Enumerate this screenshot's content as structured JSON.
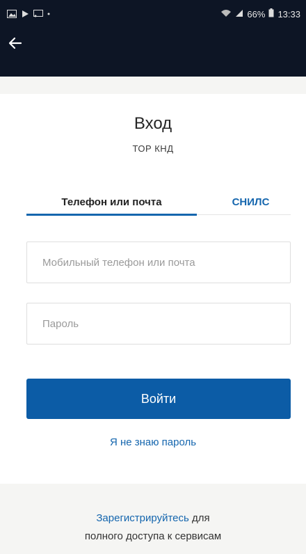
{
  "status_bar": {
    "battery": "66%",
    "time": "13:33",
    "icons": [
      "gallery-icon",
      "play-icon",
      "cast-icon",
      "wifi-icon",
      "signal-icon",
      "battery-icon"
    ]
  },
  "app_bar": {
    "back_icon": "arrow-left-icon"
  },
  "login": {
    "title": "Вход",
    "subtitle": "ТОР КНД",
    "tabs": [
      {
        "label": "Телефон или почта",
        "active": true
      },
      {
        "label": "СНИЛС",
        "active": false
      }
    ],
    "login_placeholder": "Мобильный телефон или почта",
    "login_value": "",
    "password_placeholder": "Пароль",
    "password_value": "",
    "submit_label": "Войти",
    "forgot_label": "Я не знаю пароль"
  },
  "register": {
    "link_label": "Зарегистрируйтесь",
    "text_after": " для",
    "line2": "полного доступа к сервисам"
  },
  "colors": {
    "bar_bg": "#0d1525",
    "accent": "#1566ae",
    "button": "#0c5ca6",
    "page_bg": "#f5f5f3"
  }
}
